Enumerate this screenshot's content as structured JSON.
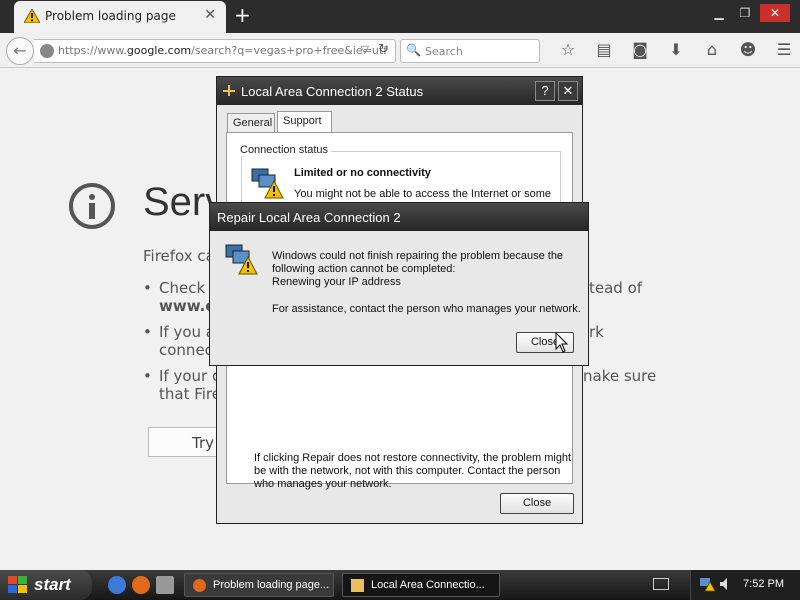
{
  "browser": {
    "tab_title": "Problem loading page",
    "new_tab_symbol": "+",
    "url_prefix": "https://www.",
    "url_domain": "google.com",
    "url_rest": "/search?q=vegas+pro+free&ie=utf",
    "search_placeholder": "Search",
    "toolbar_icons": [
      "star-icon",
      "reading-list-icon",
      "pocket-icon",
      "download-icon",
      "home-icon",
      "hello-icon",
      "menu-icon"
    ]
  },
  "error_page": {
    "title": "Serv",
    "lead": "Firefox ca",
    "bullets": [
      {
        "left": "Check t",
        "left2": "www.e",
        "right": "tead of"
      },
      {
        "left": "If you a",
        "left2": "connect",
        "right": "rk"
      },
      {
        "left": "If your c",
        "left2": "that Firef",
        "right": "nake sure"
      }
    ],
    "try_again": "Try"
  },
  "status_dialog": {
    "title": "Local Area Connection 2 Status",
    "help_symbol": "?",
    "close_symbol": "✕",
    "tabs": [
      "General",
      "Support"
    ],
    "active_tab": "Support",
    "group_label": "Connection status",
    "status_heading": "Limited or no connectivity",
    "status_text": "You might not be able to access the Internet or some",
    "repair_note": "If clicking Repair does not restore connectivity, the problem might be with the network, not with this computer. Contact the person who manages your network.",
    "close_button": "Close"
  },
  "repair_dialog": {
    "title": "Repair Local Area Connection 2",
    "message_line1": "Windows could not finish repairing the problem because the",
    "message_line2": "following action cannot be completed:",
    "message_line3": "Renewing your IP address",
    "assistance": "For assistance, contact the person who manages your network.",
    "close_button": "Close"
  },
  "taskbar": {
    "start_label": "start",
    "tasks": [
      "Problem loading page...",
      "Local Area Connectio..."
    ],
    "clock": "7:52 PM"
  },
  "colors": {
    "titlebar": "#2b2b2b",
    "warning": "#f2c200",
    "page_bg": "#f1f1f1"
  }
}
